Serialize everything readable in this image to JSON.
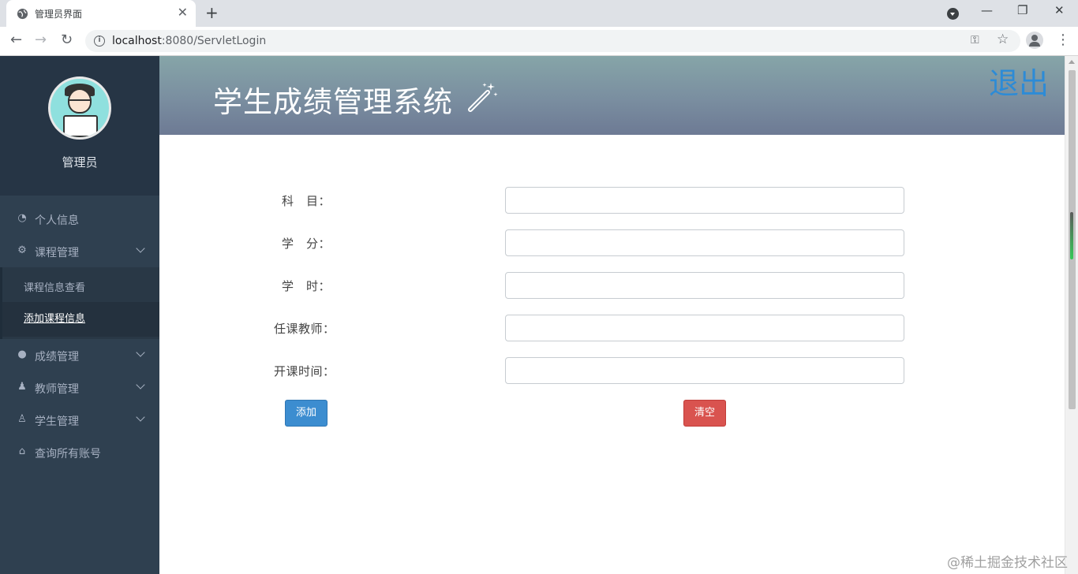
{
  "browser": {
    "tab_title": "管理员界面",
    "tab_close": "✕",
    "new_tab": "+",
    "url_host": "localhost",
    "url_rest": ":8080/ServletLogin",
    "win_min": "—",
    "win_restore": "❐",
    "win_close": "✕",
    "back": "←",
    "forward": "→",
    "reload": "↻",
    "info": "i",
    "key": "⚿",
    "star": "☆",
    "menu": "⋮"
  },
  "sidebar": {
    "profile_name": "管理员",
    "items": [
      {
        "label": "个人信息",
        "icon": "dashboard-icon",
        "glyph": "◔"
      },
      {
        "label": "课程管理",
        "icon": "gears-icon",
        "glyph": "⚙"
      },
      {
        "label": "成绩管理",
        "icon": "comments-icon",
        "glyph": "●"
      },
      {
        "label": "教师管理",
        "icon": "users-icon",
        "glyph": "♟"
      },
      {
        "label": "学生管理",
        "icon": "user-icon",
        "glyph": "♙"
      },
      {
        "label": "查询所有账号",
        "icon": "bank-icon",
        "glyph": "⌂"
      }
    ],
    "submenu": [
      {
        "label": "课程信息查看"
      },
      {
        "label": "添加课程信息",
        "active": true
      }
    ]
  },
  "header": {
    "title": "学生成绩管理系统",
    "logout": "退出"
  },
  "form": {
    "fields": [
      {
        "label": "科　目：",
        "value": ""
      },
      {
        "label": "学　分：",
        "value": ""
      },
      {
        "label": "学　时：",
        "value": ""
      },
      {
        "label": "任课教师：",
        "value": ""
      },
      {
        "label": "开课时间：",
        "value": ""
      }
    ],
    "add_button": "添加",
    "clear_button": "清空"
  },
  "watermark": "@稀土掘金技术社区",
  "colors": {
    "sidebar_bg": "#2f4050",
    "header_gradient": "#7a8ea0",
    "logout": "#2d8bd6",
    "btn_add": "#3c8dd0",
    "btn_clear": "#d9534f"
  }
}
